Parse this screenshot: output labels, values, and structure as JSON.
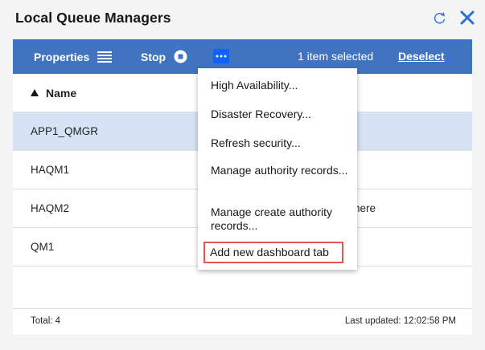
{
  "header": {
    "title": "Local Queue Managers",
    "refresh_icon": "refresh-icon",
    "close_icon": "close-icon"
  },
  "toolbar": {
    "properties_label": "Properties",
    "properties_icon": "list-icon",
    "stop_label": "Stop",
    "stop_icon": "stop-icon",
    "more_icon": "overflow-menu-icon",
    "selection_text": "1 item selected",
    "deselect_label": "Deselect"
  },
  "table": {
    "columns": [
      {
        "label": "Name",
        "sort": "ascending"
      }
    ],
    "rows": [
      {
        "name": "APP1_QMGR",
        "selected": true,
        "extra": ""
      },
      {
        "name": "HAQM1",
        "selected": false,
        "extra": ""
      },
      {
        "name": "HAQM2",
        "selected": false,
        "extra": "nere"
      },
      {
        "name": "QM1",
        "selected": false,
        "extra": ""
      }
    ],
    "footer": {
      "total": "Total: 4",
      "last_updated": "Last updated: 12:02:58 PM"
    }
  },
  "context_menu": {
    "items": [
      "High Availability...",
      "Disaster Recovery...",
      "Refresh security...",
      "Manage authority records...",
      "Manage create authority records...",
      "Add new dashboard tab"
    ],
    "highlighted_index": 5
  },
  "colors": {
    "toolbar": "#4174c0",
    "selected_row": "#d5e3f5",
    "accent": "#0f62fe",
    "highlight_outline": "#e0564e"
  }
}
